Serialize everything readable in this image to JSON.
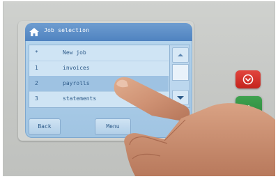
{
  "screen": {
    "title": "Job selection",
    "rows": [
      {
        "num": "*",
        "label": "New job"
      },
      {
        "num": "1",
        "label": "invoices"
      },
      {
        "num": "2",
        "label": "payrolls"
      },
      {
        "num": "3",
        "label": "statements"
      }
    ],
    "buttons": {
      "back": "Back",
      "menu": "Menu"
    }
  },
  "icons": {
    "home": "home-icon",
    "stop": "stop-icon",
    "start": "start-diamond-icon"
  },
  "colors": {
    "titlebar": "#4f83c0",
    "screen_bg": "#a9cbe7",
    "stop_button": "#d22a24",
    "start_button": "#2e8f40"
  }
}
